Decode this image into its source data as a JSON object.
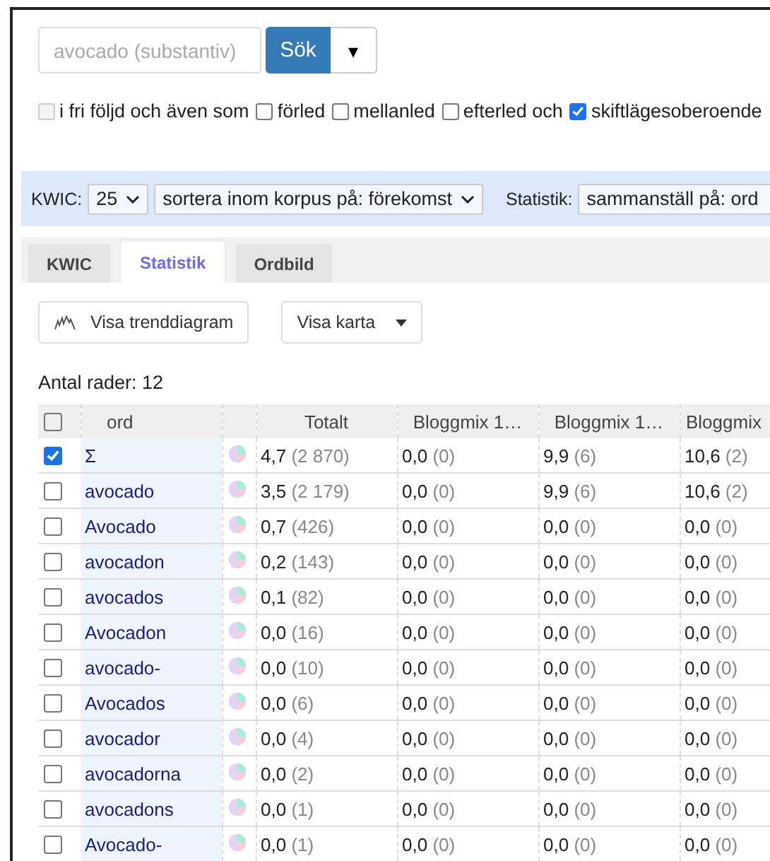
{
  "search": {
    "placeholder": "avocado (substantiv)",
    "button": "Sök",
    "menu_icon": "▾"
  },
  "options": [
    {
      "label": "i fri följd och även som",
      "checked": false,
      "disabled": true
    },
    {
      "label": "förled",
      "checked": false,
      "disabled": false
    },
    {
      "label": "mellanled",
      "checked": false,
      "disabled": false
    },
    {
      "label": "efterled och",
      "checked": false,
      "disabled": false
    },
    {
      "label": "skiftlägesoberoende",
      "checked": true,
      "disabled": false
    }
  ],
  "toolbar": {
    "kwic_label": "KWIC:",
    "kwic_count": "25",
    "sort": "sortera inom korpus på: förekomst",
    "stats_label": "Statistik:",
    "stats_value": "sammanställ på: ord"
  },
  "tabs": [
    {
      "label": "KWIC",
      "selected": false
    },
    {
      "label": "Statistik",
      "selected": true
    },
    {
      "label": "Ordbild",
      "selected": false
    }
  ],
  "actions": {
    "trend": "Visa trenddiagram",
    "map": "Visa karta"
  },
  "row_count": "Antal rader: 12",
  "table": {
    "header_checked": false,
    "word_header": "ord",
    "columns": [
      "Totalt",
      "Bloggmix 1…",
      "Bloggmix 1…",
      "Bloggmix"
    ],
    "rows": [
      {
        "checked": true,
        "word": "Σ",
        "cells": [
          [
            "4,7",
            "(2 870)"
          ],
          [
            "0,0",
            "(0)"
          ],
          [
            "9,9",
            "(6)"
          ],
          [
            "10,6",
            "(2)"
          ]
        ]
      },
      {
        "checked": false,
        "word": "avocado",
        "cells": [
          [
            "3,5",
            "(2 179)"
          ],
          [
            "0,0",
            "(0)"
          ],
          [
            "9,9",
            "(6)"
          ],
          [
            "10,6",
            "(2)"
          ]
        ]
      },
      {
        "checked": false,
        "word": "Avocado",
        "cells": [
          [
            "0,7",
            "(426)"
          ],
          [
            "0,0",
            "(0)"
          ],
          [
            "0,0",
            "(0)"
          ],
          [
            "0,0",
            "(0)"
          ]
        ]
      },
      {
        "checked": false,
        "word": "avocadon",
        "cells": [
          [
            "0,2",
            "(143)"
          ],
          [
            "0,0",
            "(0)"
          ],
          [
            "0,0",
            "(0)"
          ],
          [
            "0,0",
            "(0)"
          ]
        ]
      },
      {
        "checked": false,
        "word": "avocados",
        "cells": [
          [
            "0,1",
            "(82)"
          ],
          [
            "0,0",
            "(0)"
          ],
          [
            "0,0",
            "(0)"
          ],
          [
            "0,0",
            "(0)"
          ]
        ]
      },
      {
        "checked": false,
        "word": "Avocadon",
        "cells": [
          [
            "0,0",
            "(16)"
          ],
          [
            "0,0",
            "(0)"
          ],
          [
            "0,0",
            "(0)"
          ],
          [
            "0,0",
            "(0)"
          ]
        ]
      },
      {
        "checked": false,
        "word": "avocado-",
        "cells": [
          [
            "0,0",
            "(10)"
          ],
          [
            "0,0",
            "(0)"
          ],
          [
            "0,0",
            "(0)"
          ],
          [
            "0,0",
            "(0)"
          ]
        ]
      },
      {
        "checked": false,
        "word": "Avocados",
        "cells": [
          [
            "0,0",
            "(6)"
          ],
          [
            "0,0",
            "(0)"
          ],
          [
            "0,0",
            "(0)"
          ],
          [
            "0,0",
            "(0)"
          ]
        ]
      },
      {
        "checked": false,
        "word": "avocador",
        "cells": [
          [
            "0,0",
            "(4)"
          ],
          [
            "0,0",
            "(0)"
          ],
          [
            "0,0",
            "(0)"
          ],
          [
            "0,0",
            "(0)"
          ]
        ]
      },
      {
        "checked": false,
        "word": "avocadorna",
        "cells": [
          [
            "0,0",
            "(2)"
          ],
          [
            "0,0",
            "(0)"
          ],
          [
            "0,0",
            "(0)"
          ],
          [
            "0,0",
            "(0)"
          ]
        ]
      },
      {
        "checked": false,
        "word": "avocadons",
        "cells": [
          [
            "0,0",
            "(1)"
          ],
          [
            "0,0",
            "(0)"
          ],
          [
            "0,0",
            "(0)"
          ],
          [
            "0,0",
            "(0)"
          ]
        ]
      },
      {
        "checked": false,
        "word": "Avocado-",
        "cells": [
          [
            "0,0",
            "(1)"
          ],
          [
            "0,0",
            "(0)"
          ],
          [
            "0,0",
            "(0)"
          ],
          [
            "0,0",
            "(0)"
          ]
        ]
      }
    ]
  }
}
